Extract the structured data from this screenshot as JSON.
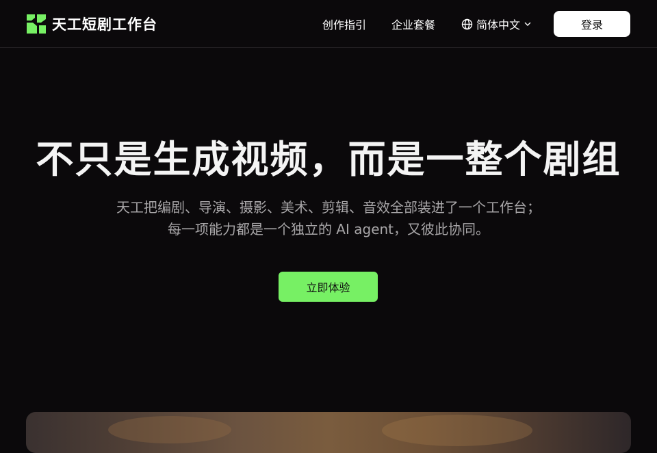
{
  "header": {
    "brand_name": "天工短剧工作台",
    "logo_icon": "tiangong-logo-icon",
    "nav": {
      "guide_label": "创作指引",
      "enterprise_label": "企业套餐"
    },
    "language": {
      "label": "简体中文",
      "icon": "globe-icon",
      "chevron": "chevron-down-icon"
    },
    "login_label": "登录"
  },
  "hero": {
    "title": "不只是生成视频，而是一整个剧组",
    "subtitle_line1": "天工把编剧、导演、摄影、美术、剪辑、音效全部装进了一个工作台；",
    "subtitle_line2": "每一项能力都是一个独立的 AI agent，又彼此协同。",
    "cta_label": "立即体验"
  },
  "colors": {
    "background": "#0b090b",
    "accent_green": "#77f064",
    "login_button_bg": "#ffffff",
    "subtitle_gray": "#a8a6a8"
  }
}
